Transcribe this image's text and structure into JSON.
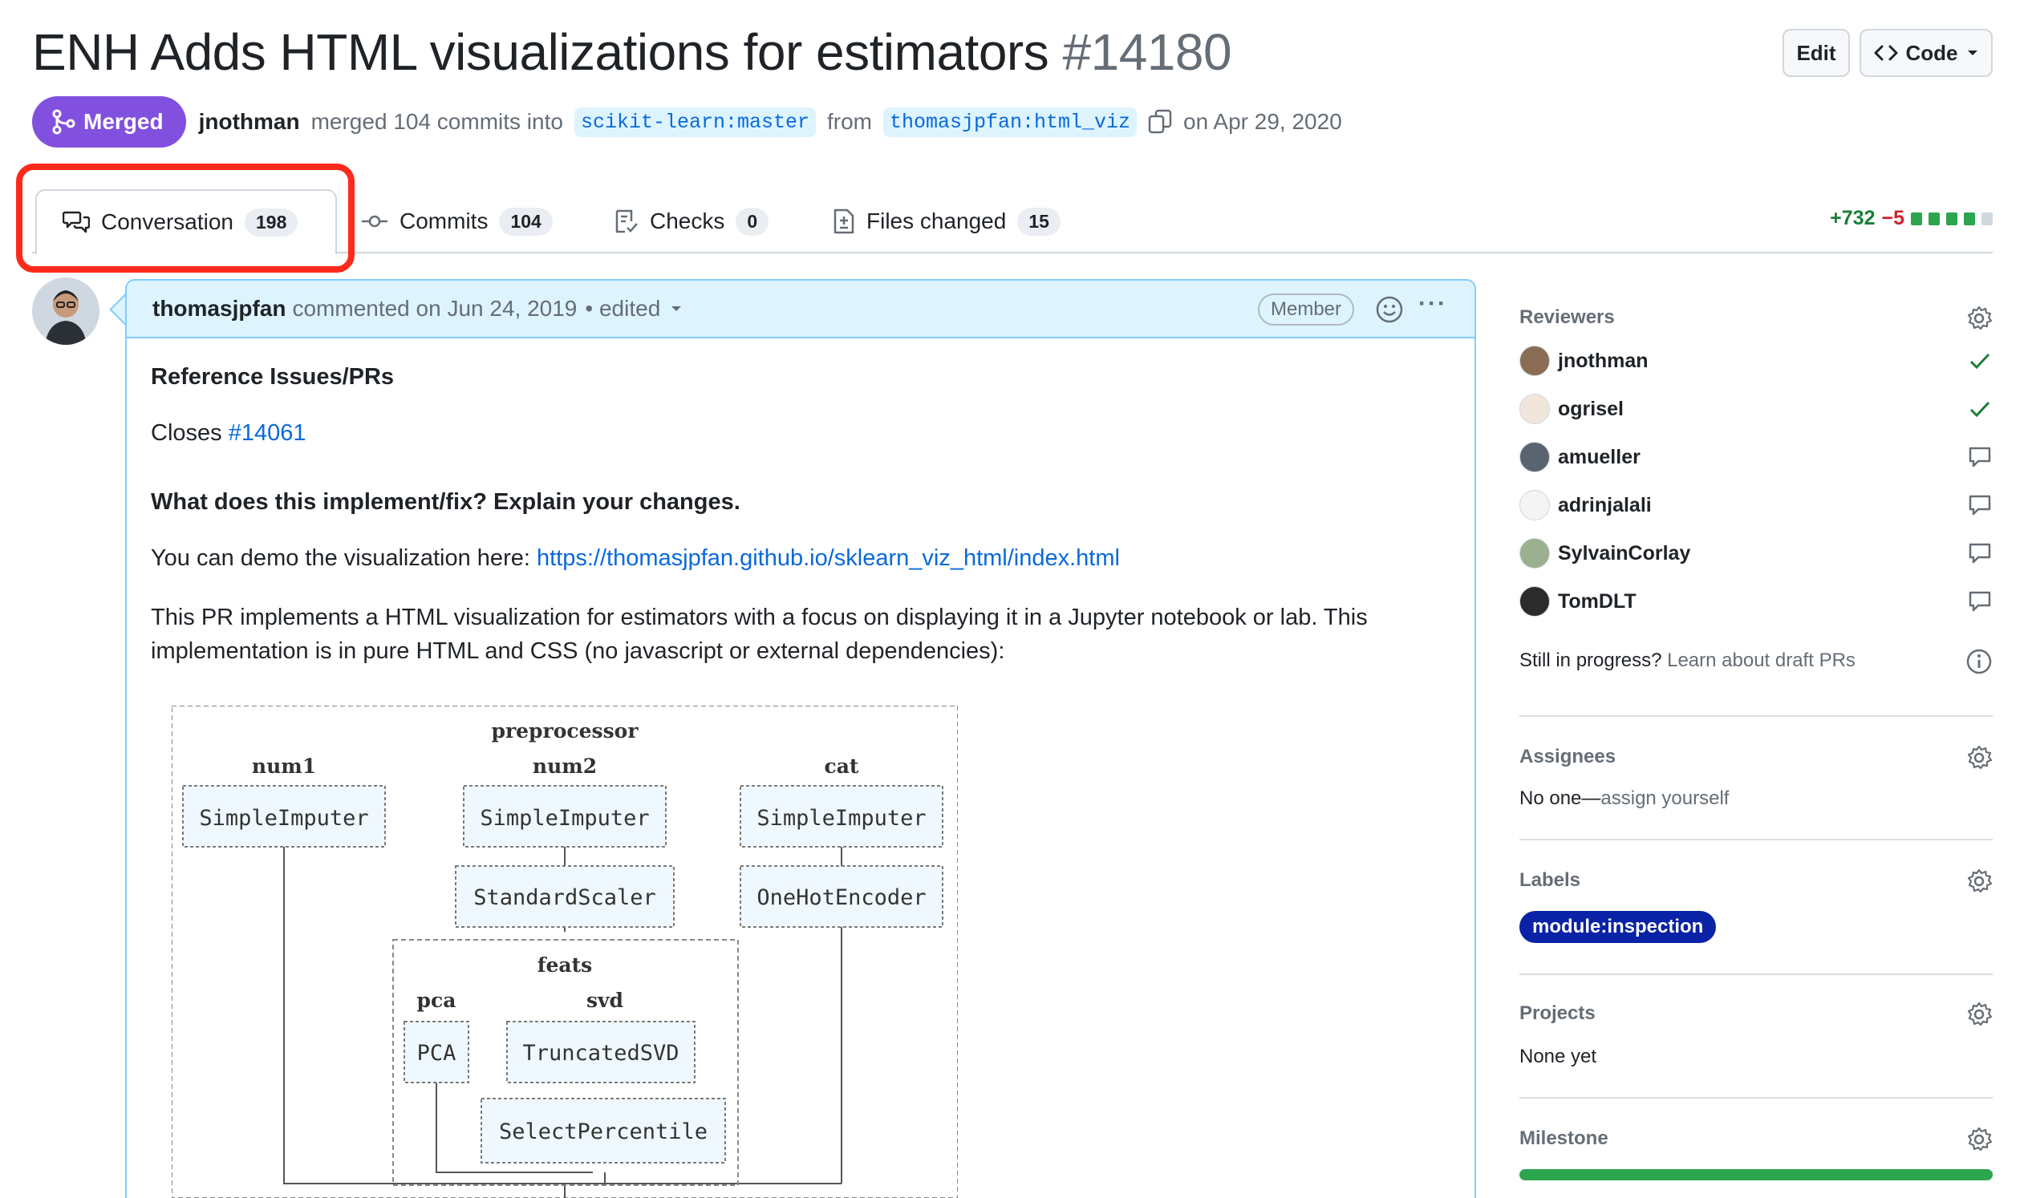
{
  "header": {
    "title": "ENH Adds HTML visualizations for estimators",
    "number": "#14180",
    "edit_label": "Edit",
    "code_label": "Code"
  },
  "meta": {
    "status": "Merged",
    "merger": "jnothman",
    "merged_text": "merged 104 commits into",
    "base_branch": "scikit-learn:master",
    "from_text": "from",
    "head_branch": "thomasjpfan:html_viz",
    "date_text": "on Apr 29, 2020"
  },
  "tabs": [
    {
      "label": "Conversation",
      "count": "198"
    },
    {
      "label": "Commits",
      "count": "104"
    },
    {
      "label": "Checks",
      "count": "0"
    },
    {
      "label": "Files changed",
      "count": "15"
    }
  ],
  "diffstat": {
    "additions": "+732",
    "deletions": "−5"
  },
  "comment": {
    "author": "thomasjpfan",
    "action": "commented on Jun 24, 2019",
    "edited": "• edited",
    "role_badge": "Member",
    "heading1": "Reference Issues/PRs",
    "closes_text": "Closes",
    "closes_link": "#14061",
    "heading2": "What does this implement/fix? Explain your changes.",
    "demo_text": "You can demo the visualization here:",
    "demo_link": "https://thomasjpfan.github.io/sklearn_viz_html/index.html",
    "para_line1": "This PR implements a HTML visualization for estimators with a focus on displaying it in a Jupyter notebook or lab. This",
    "para_line2": "implementation is in pure HTML and CSS (no javascript or external dependencies):"
  },
  "diagram": {
    "preprocessor": "preprocessor",
    "num1": "num1",
    "num2": "num2",
    "cat": "cat",
    "imputer1": "SimpleImputer",
    "imputer2": "SimpleImputer",
    "imputer3": "SimpleImputer",
    "scaler": "StandardScaler",
    "encoder": "OneHotEncoder",
    "feats": "feats",
    "pca_label": "pca",
    "svd_label": "svd",
    "pca": "PCA",
    "svd": "TruncatedSVD",
    "select": "SelectPercentile"
  },
  "sidebar": {
    "reviewers_title": "Reviewers",
    "reviewers": [
      {
        "name": "jnothman",
        "status": "approved"
      },
      {
        "name": "ogrisel",
        "status": "approved"
      },
      {
        "name": "amueller",
        "status": "commented"
      },
      {
        "name": "adrinjalali",
        "status": "commented"
      },
      {
        "name": "SylvainCorlay",
        "status": "commented"
      },
      {
        "name": "TomDLT",
        "status": "commented"
      }
    ],
    "draft_q": "Still in progress?",
    "draft_link": "Learn about draft PRs",
    "assignees_title": "Assignees",
    "assignees_none": "No one—",
    "assignees_link": "assign yourself",
    "labels_title": "Labels",
    "label": "module:inspection",
    "label_color": "#0a22a5",
    "projects_title": "Projects",
    "projects_none": "None yet",
    "milestone_title": "Milestone",
    "milestone_progress": 1.0
  },
  "colors": {
    "merged": "#8250df",
    "link": "#0969da",
    "highlight": "#ff2a1a",
    "approve": "#1a7f37"
  }
}
